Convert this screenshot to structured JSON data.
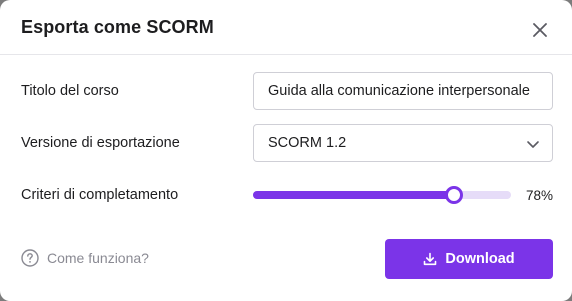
{
  "dialog": {
    "title": "Esporta come SCORM",
    "close_icon": "close-icon"
  },
  "fields": {
    "course_title": {
      "label": "Titolo del corso",
      "value": "Guida alla comunicazione interpersonale"
    },
    "export_version": {
      "label": "Versione di esportazione",
      "selected": "SCORM 1.2"
    },
    "completion": {
      "label": "Criteri di completamento",
      "value_percent": 78,
      "display": "78%"
    }
  },
  "footer": {
    "help_label": "Come funziona?",
    "help_icon": "question-circle-icon",
    "download_label": "Download",
    "download_icon": "download-icon"
  },
  "colors": {
    "accent": "#7b34e8",
    "track": "#e6dcf8",
    "muted_text": "#8a8a93"
  }
}
